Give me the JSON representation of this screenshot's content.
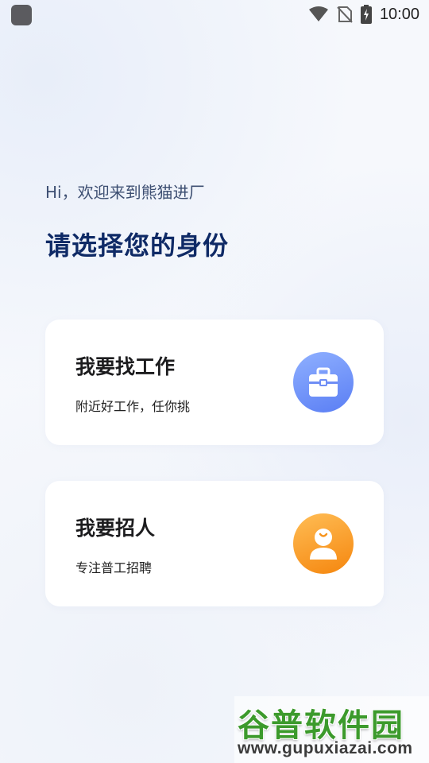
{
  "status_bar": {
    "time": "10:00"
  },
  "header": {
    "greeting": "Hi，欢迎来到熊猫进厂",
    "title": "请选择您的身份"
  },
  "options": [
    {
      "title": "我要找工作",
      "subtitle": "附近好工作，任你挑",
      "icon": "briefcase-icon",
      "accent": "#5a7ef4"
    },
    {
      "title": "我要招人",
      "subtitle": "专注普工招聘",
      "icon": "user-icon",
      "accent": "#f5860e"
    }
  ],
  "watermark": {
    "title": "谷普软件园",
    "url": "www.gupuxiazai.com"
  }
}
